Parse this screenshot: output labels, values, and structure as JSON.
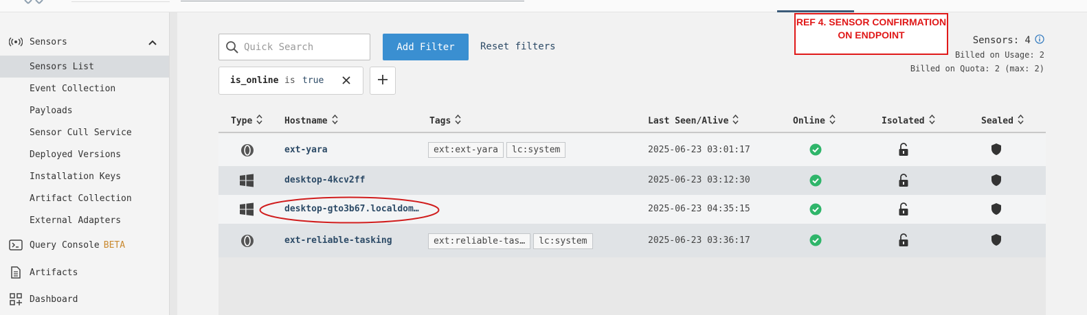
{
  "sidebar": {
    "sensors_section": {
      "label": "Sensors"
    },
    "items": [
      {
        "label": "Sensors List",
        "active": true
      },
      {
        "label": "Event Collection"
      },
      {
        "label": "Payloads"
      },
      {
        "label": "Sensor Cull Service"
      },
      {
        "label": "Deployed Versions"
      },
      {
        "label": "Installation Keys"
      },
      {
        "label": "Artifact Collection"
      },
      {
        "label": "External Adapters"
      }
    ],
    "query_console": {
      "label": "Query Console",
      "badge": "BETA"
    },
    "artifacts": {
      "label": "Artifacts"
    },
    "dashboard": {
      "label": "Dashboard"
    }
  },
  "toolbar": {
    "search_placeholder": "Quick Search",
    "add_filter_label": "Add Filter",
    "reset_filters_label": "Reset filters"
  },
  "filter_chip": {
    "key": "is_online",
    "operator": "is",
    "value": "true"
  },
  "annotation": {
    "ref_text": "REF 4. SENSOR CONFIRMATION ON ENDPOINT"
  },
  "stats": {
    "sensors_label": "Sensors: 4",
    "billed_usage": "Billed on Usage: 2",
    "billed_quota": "Billed on Quota: 2 (max: 2)"
  },
  "table": {
    "columns": [
      "Type",
      "Hostname",
      "Tags",
      "Last Seen/Alive",
      "Online",
      "Isolated",
      "Sealed"
    ],
    "rows": [
      {
        "type_icon": "extension-icon",
        "hostname": "ext-yara",
        "tags": [
          "ext:ext-yara",
          "lc:system"
        ],
        "last_seen": "2025-06-23 03:01:17",
        "online": true,
        "isolated": false,
        "sealed": true
      },
      {
        "type_icon": "windows-icon",
        "hostname": "desktop-4kcv2ff",
        "tags": [],
        "last_seen": "2025-06-23 03:12:30",
        "online": true,
        "isolated": false,
        "sealed": true
      },
      {
        "type_icon": "windows-icon",
        "hostname": "desktop-gto3b67.localdom…",
        "tags": [],
        "last_seen": "2025-06-23 04:35:15",
        "online": true,
        "isolated": false,
        "sealed": true
      },
      {
        "type_icon": "extension-icon",
        "hostname": "ext-reliable-tasking",
        "tags": [
          "ext:reliable-tas…",
          "lc:system"
        ],
        "last_seen": "2025-06-23 03:36:17",
        "online": true,
        "isolated": false,
        "sealed": true
      }
    ]
  },
  "colors": {
    "primary": "#3a8fd1",
    "link": "#2c4a66",
    "online": "#2fb56a",
    "annotation": "#e01818"
  }
}
